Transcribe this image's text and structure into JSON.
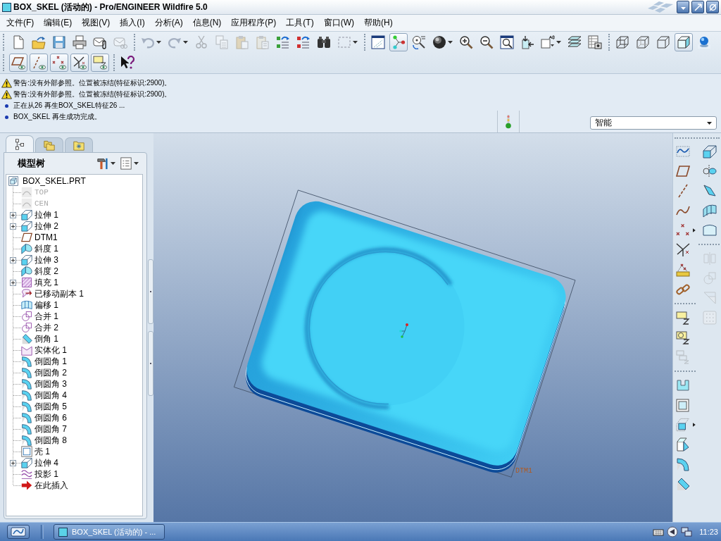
{
  "window": {
    "title": "BOX_SKEL (活动的) - Pro/ENGINEER Wildfire 5.0"
  },
  "menu": [
    "文件(F)",
    "编辑(E)",
    "视图(V)",
    "插入(I)",
    "分析(A)",
    "信息(N)",
    "应用程序(P)",
    "工具(T)",
    "窗口(W)",
    "帮助(H)"
  ],
  "toolbar_rows": [
    {
      "groups": [
        [
          {
            "kind": "new",
            "on": false,
            "disabled": false,
            "dropdown": false
          },
          {
            "kind": "open",
            "on": false,
            "disabled": false,
            "dropdown": false
          },
          {
            "kind": "save",
            "on": false,
            "disabled": false,
            "dropdown": false
          },
          {
            "kind": "print",
            "on": false,
            "disabled": false,
            "dropdown": false
          },
          {
            "kind": "email",
            "on": false,
            "disabled": false,
            "dropdown": false
          },
          {
            "kind": "email_link",
            "on": false,
            "disabled": true,
            "dropdown": false
          }
        ],
        [
          {
            "kind": "undo",
            "on": false,
            "disabled": true,
            "dropdown": true
          },
          {
            "kind": "redo",
            "on": false,
            "disabled": true,
            "dropdown": true
          },
          {
            "kind": "cut",
            "on": false,
            "disabled": true,
            "dropdown": false
          },
          {
            "kind": "copy",
            "on": false,
            "disabled": true,
            "dropdown": false
          },
          {
            "kind": "paste",
            "on": false,
            "disabled": true,
            "dropdown": false
          },
          {
            "kind": "paste_special",
            "on": false,
            "disabled": true,
            "dropdown": false
          },
          {
            "kind": "regenerate",
            "on": false,
            "disabled": false,
            "dropdown": false
          },
          {
            "kind": "regen_manager",
            "on": false,
            "disabled": false,
            "dropdown": false
          },
          {
            "kind": "find",
            "on": false,
            "disabled": false,
            "dropdown": false
          },
          {
            "kind": "select_box",
            "on": false,
            "disabled": true,
            "dropdown": true
          }
        ],
        [
          {
            "kind": "repaint",
            "on": false,
            "disabled": false,
            "dropdown": false
          },
          {
            "kind": "spin_center",
            "on": true,
            "disabled": false,
            "dropdown": false
          },
          {
            "kind": "orient_mode",
            "on": false,
            "disabled": false,
            "dropdown": false
          },
          {
            "kind": "appearance",
            "on": false,
            "disabled": false,
            "dropdown": true
          },
          {
            "kind": "zoom_in",
            "on": false,
            "disabled": false,
            "dropdown": false
          },
          {
            "kind": "zoom_out",
            "on": false,
            "disabled": false,
            "dropdown": false
          },
          {
            "kind": "refit",
            "on": false,
            "disabled": false,
            "dropdown": false
          },
          {
            "kind": "reorient",
            "on": false,
            "disabled": false,
            "dropdown": false
          },
          {
            "kind": "saved_views",
            "on": false,
            "disabled": false,
            "dropdown": true
          },
          {
            "kind": "layers",
            "on": false,
            "disabled": false,
            "dropdown": false
          },
          {
            "kind": "view_manager",
            "on": false,
            "disabled": false,
            "dropdown": false
          }
        ],
        [
          {
            "kind": "wireframe",
            "on": false,
            "disabled": false,
            "dropdown": false
          },
          {
            "kind": "hidden_line",
            "on": false,
            "disabled": false,
            "dropdown": false
          },
          {
            "kind": "no_hidden",
            "on": false,
            "disabled": false,
            "dropdown": false
          },
          {
            "kind": "shading",
            "on": true,
            "disabled": false,
            "dropdown": false
          },
          {
            "kind": "realism",
            "on": false,
            "disabled": false,
            "dropdown": false
          }
        ]
      ]
    },
    {
      "groups": [
        [
          {
            "kind": "plane_display",
            "on": true,
            "disabled": false,
            "dropdown": false
          },
          {
            "kind": "axis_display",
            "on": true,
            "disabled": false,
            "dropdown": false
          },
          {
            "kind": "point_display",
            "on": true,
            "disabled": false,
            "dropdown": false
          },
          {
            "kind": "csys_display",
            "on": true,
            "disabled": false,
            "dropdown": false
          },
          {
            "kind": "annotation_display",
            "on": true,
            "disabled": false,
            "dropdown": false
          }
        ],
        [
          {
            "kind": "whats_this",
            "on": false,
            "disabled": false,
            "dropdown": false
          }
        ]
      ]
    }
  ],
  "messages": [
    {
      "kind": "warning",
      "text": "警告:没有外部参照。位置被冻结(特征标识:2900)。"
    },
    {
      "kind": "warning",
      "text": "警告:没有外部参照。位置被冻结(特征标识:2900)。"
    },
    {
      "kind": "info",
      "text": "正在从26 再生BOX_SKEL特征26 ..."
    },
    {
      "kind": "info",
      "text": "BOX_SKEL 再生成功完成。"
    }
  ],
  "filter": {
    "value": "智能"
  },
  "panel_tabs": [
    {
      "kind": "model_tree",
      "selected": true
    },
    {
      "kind": "folder_browser",
      "selected": false
    },
    {
      "kind": "favorites",
      "selected": false
    }
  ],
  "model_tree": {
    "title": "模型树",
    "root": {
      "label": "BOX_SKEL.PRT",
      "kind": "part",
      "children": [
        {
          "label": "TOP",
          "kind": "hidden_plane",
          "dimmed": true,
          "collapsed": false
        },
        {
          "label": "CEN",
          "kind": "hidden_plane",
          "dimmed": true,
          "collapsed": false
        },
        {
          "label": "拉伸 1",
          "kind": "extrude",
          "dimmed": false,
          "collapsed": true
        },
        {
          "label": "拉伸 2",
          "kind": "extrude",
          "dimmed": false,
          "collapsed": true
        },
        {
          "label": "DTM1",
          "kind": "datum_plane",
          "dimmed": false,
          "collapsed": false
        },
        {
          "label": "斜度 1",
          "kind": "draft",
          "dimmed": false,
          "collapsed": false
        },
        {
          "label": "拉伸 3",
          "kind": "extrude",
          "dimmed": false,
          "collapsed": true
        },
        {
          "label": "斜度 2",
          "kind": "draft",
          "dimmed": false,
          "collapsed": false
        },
        {
          "label": "填充 1",
          "kind": "fill",
          "dimmed": false,
          "collapsed": true
        },
        {
          "label": "已移动副本 1",
          "kind": "moved_copy",
          "dimmed": false,
          "collapsed": false
        },
        {
          "label": "偏移 1",
          "kind": "offset",
          "dimmed": false,
          "collapsed": false
        },
        {
          "label": "合并 1",
          "kind": "merge",
          "dimmed": false,
          "collapsed": false
        },
        {
          "label": "合并 2",
          "kind": "merge",
          "dimmed": false,
          "collapsed": false
        },
        {
          "label": "倒角 1",
          "kind": "chamfer",
          "dimmed": false,
          "collapsed": false
        },
        {
          "label": "实体化 1",
          "kind": "solidify",
          "dimmed": false,
          "collapsed": false
        },
        {
          "label": "倒圆角 1",
          "kind": "round",
          "dimmed": false,
          "collapsed": false
        },
        {
          "label": "倒圆角 2",
          "kind": "round",
          "dimmed": false,
          "collapsed": false
        },
        {
          "label": "倒圆角 3",
          "kind": "round",
          "dimmed": false,
          "collapsed": false
        },
        {
          "label": "倒圆角 4",
          "kind": "round",
          "dimmed": false,
          "collapsed": false
        },
        {
          "label": "倒圆角 5",
          "kind": "round",
          "dimmed": false,
          "collapsed": false
        },
        {
          "label": "倒圆角 6",
          "kind": "round",
          "dimmed": false,
          "collapsed": false
        },
        {
          "label": "倒圆角 7",
          "kind": "round",
          "dimmed": false,
          "collapsed": false
        },
        {
          "label": "倒圆角 8",
          "kind": "round",
          "dimmed": false,
          "collapsed": false
        },
        {
          "label": "壳 1",
          "kind": "shell",
          "dimmed": false,
          "collapsed": false
        },
        {
          "label": "拉伸 4",
          "kind": "extrude",
          "dimmed": false,
          "collapsed": true
        },
        {
          "label": "投影 1",
          "kind": "project",
          "dimmed": false,
          "collapsed": false
        },
        {
          "label": "在此插入",
          "kind": "insert_here",
          "dimmed": false,
          "collapsed": false
        }
      ]
    }
  },
  "graphics": {
    "datum_label": "DTM1"
  },
  "feature_toolbar": {
    "columns": [
      {
        "groups": [
          [
            {
              "kind": "sketch",
              "disabled": false,
              "flyout": false
            },
            {
              "kind": "datum_plane",
              "disabled": false,
              "flyout": false
            },
            {
              "kind": "datum_axis",
              "disabled": false,
              "flyout": false
            },
            {
              "kind": "datum_curve",
              "disabled": false,
              "flyout": false
            },
            {
              "kind": "datum_point",
              "disabled": false,
              "flyout": true
            },
            {
              "kind": "csys",
              "disabled": false,
              "flyout": false
            },
            {
              "kind": "analysis",
              "disabled": false,
              "flyout": false
            },
            {
              "kind": "chain",
              "disabled": false,
              "flyout": false
            }
          ],
          [
            {
              "kind": "note",
              "disabled": false,
              "flyout": false
            },
            {
              "kind": "note_symbol",
              "disabled": false,
              "flyout": false
            },
            {
              "kind": "note_multi",
              "disabled": true,
              "flyout": false
            }
          ],
          [
            {
              "kind": "hole",
              "disabled": false,
              "flyout": false
            },
            {
              "kind": "shell",
              "disabled": false,
              "flyout": false
            },
            {
              "kind": "rib",
              "disabled": false,
              "flyout": true
            },
            {
              "kind": "draft",
              "disabled": false,
              "flyout": false
            },
            {
              "kind": "round",
              "disabled": false,
              "flyout": false
            },
            {
              "kind": "chamfer",
              "disabled": false,
              "flyout": false
            }
          ]
        ]
      },
      {
        "groups": [
          [
            {
              "kind": "extrude",
              "disabled": false,
              "flyout": false
            },
            {
              "kind": "revolve",
              "disabled": false,
              "flyout": false
            },
            {
              "kind": "sweep",
              "disabled": false,
              "flyout": false
            },
            {
              "kind": "boundary_blend",
              "disabled": false,
              "flyout": false
            },
            {
              "kind": "fill_surface",
              "disabled": false,
              "flyout": false
            }
          ],
          [
            {
              "kind": "mirror",
              "disabled": true,
              "flyout": false
            },
            {
              "kind": "merge",
              "disabled": true,
              "flyout": false
            },
            {
              "kind": "trim",
              "disabled": true,
              "flyout": false
            },
            {
              "kind": "pattern",
              "disabled": true,
              "flyout": false
            }
          ]
        ]
      }
    ]
  },
  "taskbar": {
    "task": "BOX_SKEL (活动的) - ...",
    "clock": "11:23"
  }
}
